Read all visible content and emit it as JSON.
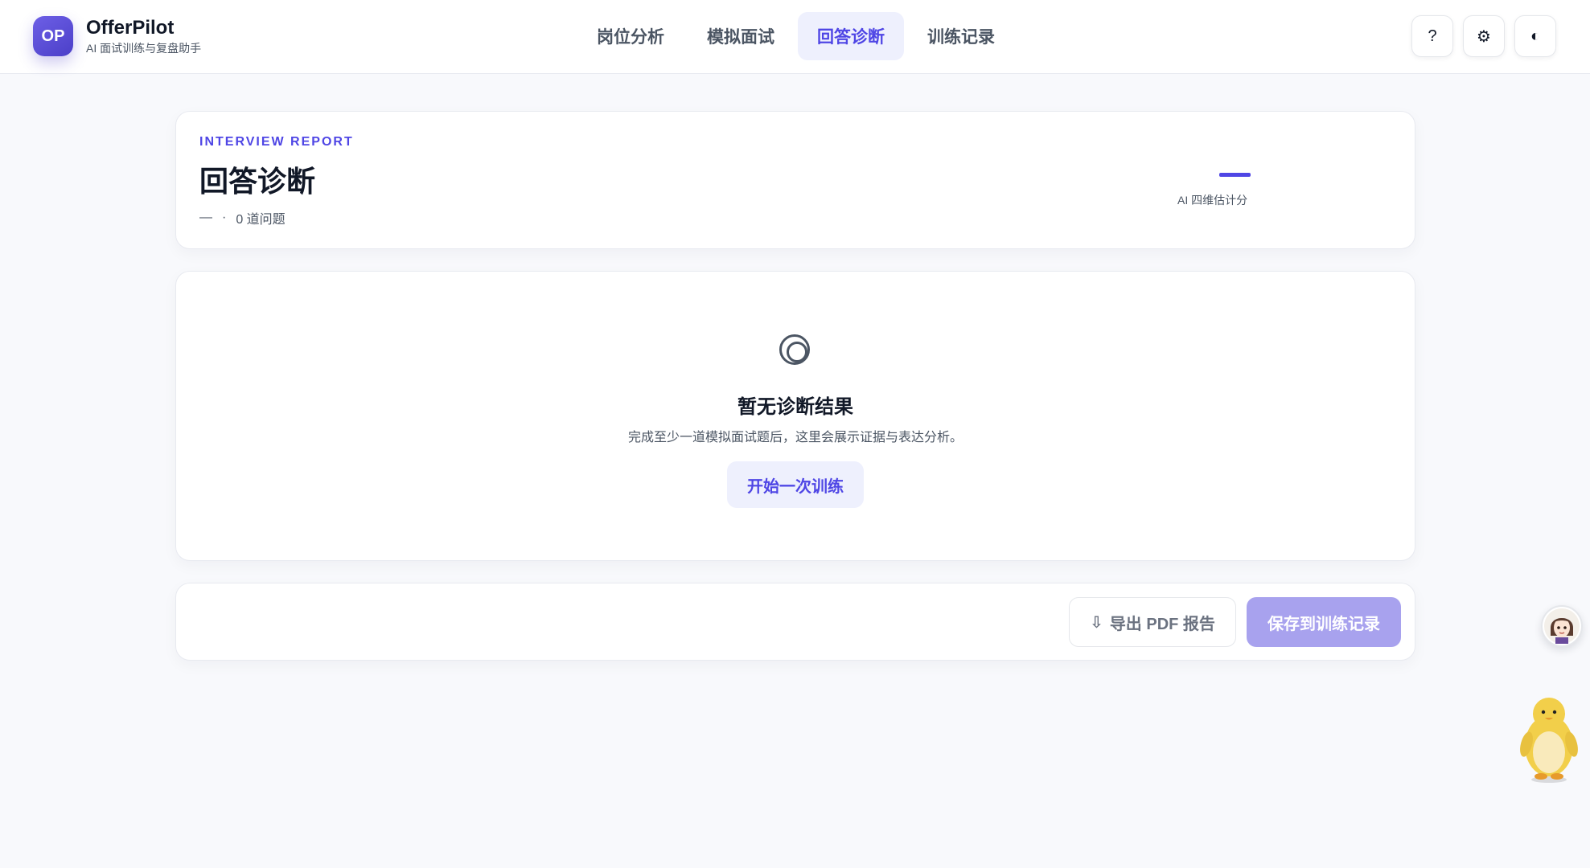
{
  "app": {
    "logo_text": "OP",
    "name": "OfferPilot",
    "subtitle": "AI 面试训练与复盘助手"
  },
  "nav": {
    "items": [
      {
        "label": "岗位分析"
      },
      {
        "label": "模拟面试"
      },
      {
        "label": "回答诊断",
        "active": true
      },
      {
        "label": "训练记录"
      }
    ]
  },
  "tools": {
    "help_label": "?",
    "settings_label": "⚙",
    "theme_label": "◐"
  },
  "report": {
    "eyebrow": "INTERVIEW REPORT",
    "title": "回答诊断",
    "meta_dash": "—",
    "meta_dot": "·",
    "meta_count": "0 道问题",
    "score_label": "AI 四维估计分"
  },
  "empty_state": {
    "icon": "target-icon",
    "title": "暂无诊断结果",
    "description": "完成至少一道模拟面试题后，这里会展示证据与表达分析。",
    "start_label": "开始一次训练"
  },
  "actions": {
    "export_icon": "⇩",
    "export_label": "导出 PDF 报告",
    "save_label": "保存到训练记录"
  },
  "colors": {
    "accent": "#4f46e5",
    "accent_soft": "#eef0fd",
    "save_disabled": "#a8a2ee",
    "background": "#f8f9fc"
  }
}
